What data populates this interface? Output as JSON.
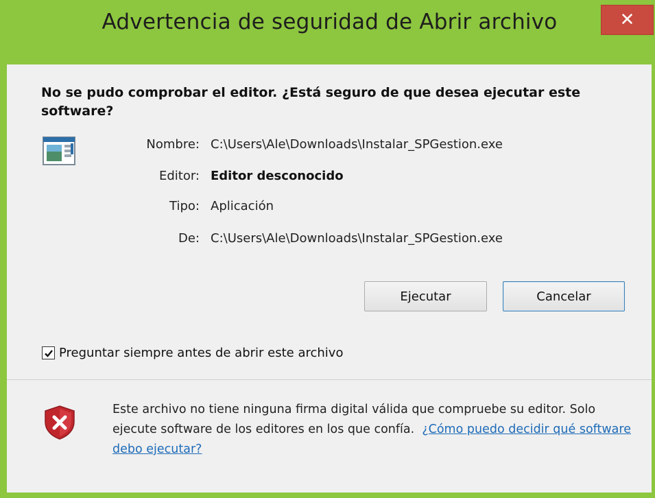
{
  "window": {
    "title": "Advertencia de seguridad de Abrir archivo",
    "close_label": "✕"
  },
  "heading": "No se pudo comprobar el editor. ¿Está seguro de que desea ejecutar este software?",
  "details": {
    "name_label": "Nombre:",
    "name_value": "C:\\Users\\Ale\\Downloads\\Instalar_SPGestion.exe",
    "publisher_label": "Editor:",
    "publisher_value": "Editor desconocido",
    "type_label": "Tipo:",
    "type_value": "Aplicación",
    "from_label": "De:",
    "from_value": "C:\\Users\\Ale\\Downloads\\Instalar_SPGestion.exe"
  },
  "buttons": {
    "run": "Ejecutar",
    "cancel": "Cancelar"
  },
  "checkbox": {
    "label": "Preguntar siempre antes de abrir este archivo",
    "checked": true
  },
  "footer": {
    "warning_text": "Este archivo no tiene ninguna firma digital válida que compruebe su editor. Solo ejecute software de los editores en los que confía.",
    "link_text": "¿Cómo puedo decidir qué software debo ejecutar?"
  },
  "colors": {
    "frame": "#8dc63f",
    "close": "#c94a3f",
    "link": "#1e6bb8"
  }
}
